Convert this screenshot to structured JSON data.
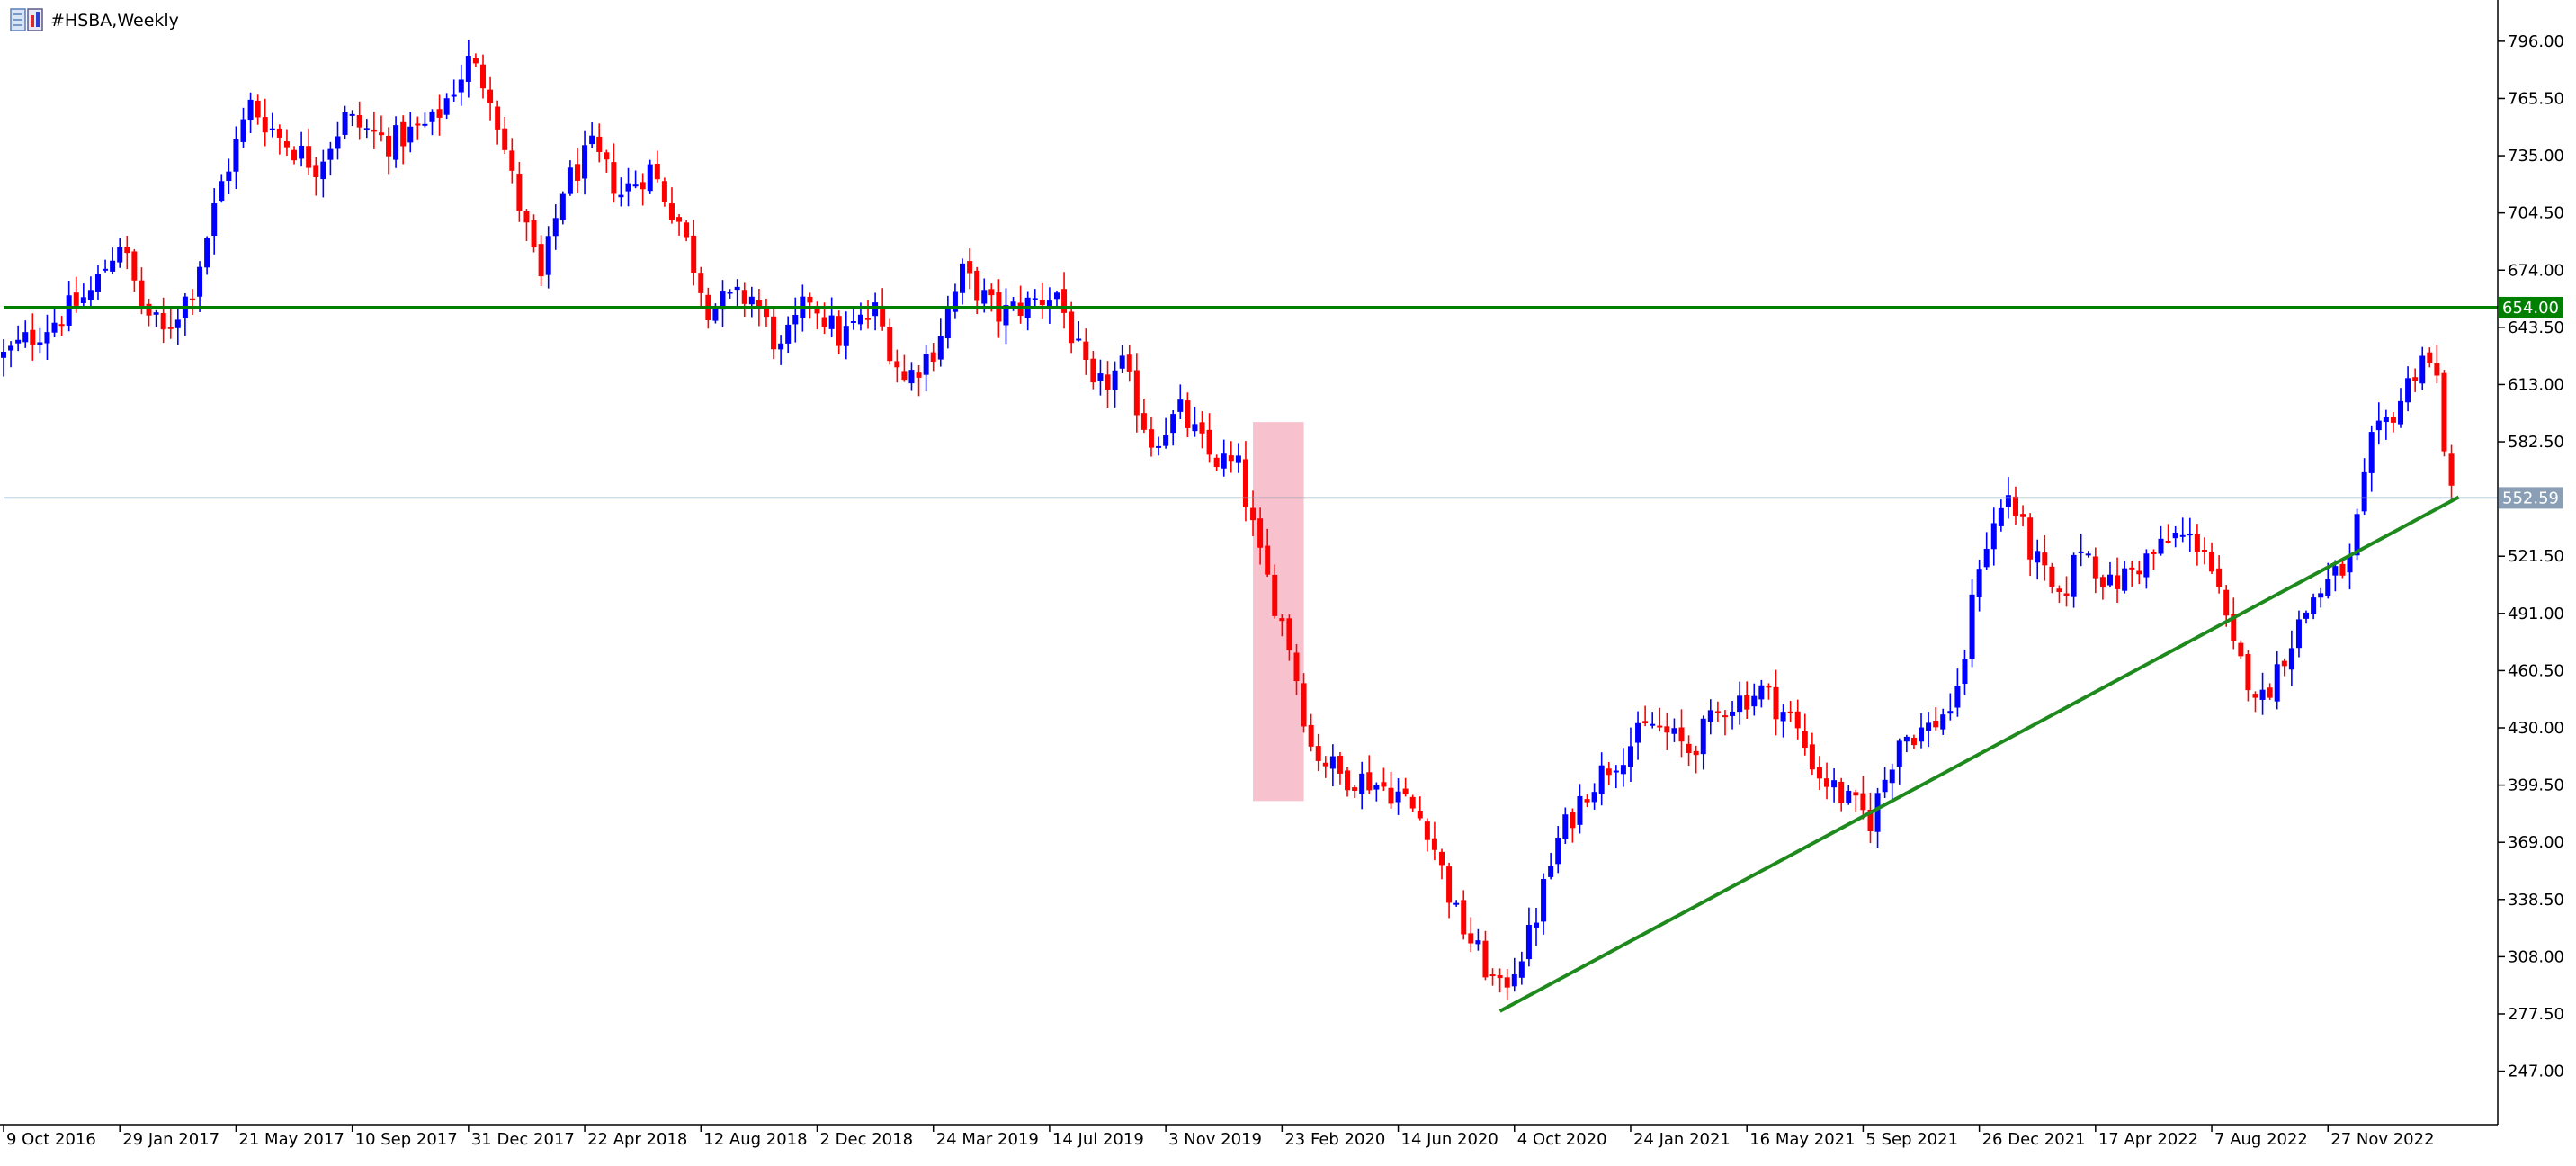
{
  "window": {
    "symbol_title": "#HSBA,Weekly"
  },
  "chart_data": {
    "type": "candlestick",
    "symbol": "#HSBA",
    "timeframe": "Weekly",
    "ylim": [
      218.5,
      818
    ],
    "xlim_dates": [
      "2016-10-09",
      "2023-05-07"
    ],
    "y_ticks": [
      "796.00",
      "765.50",
      "735.00",
      "704.50",
      "674.00",
      "643.50",
      "613.00",
      "582.50",
      "552.50",
      "521.50",
      "491.00",
      "460.50",
      "430.00",
      "399.50",
      "369.00",
      "338.50",
      "308.00",
      "277.50",
      "247.00"
    ],
    "x_ticks": [
      {
        "label": "9 Oct 2016",
        "date": "2016-10-09"
      },
      {
        "label": "29 Jan 2017",
        "date": "2017-01-29"
      },
      {
        "label": "21 May 2017",
        "date": "2017-05-21"
      },
      {
        "label": "10 Sep 2017",
        "date": "2017-09-10"
      },
      {
        "label": "31 Dec 2017",
        "date": "2017-12-31"
      },
      {
        "label": "22 Apr 2018",
        "date": "2018-04-22"
      },
      {
        "label": "12 Aug 2018",
        "date": "2018-08-12"
      },
      {
        "label": "2 Dec 2018",
        "date": "2018-12-02"
      },
      {
        "label": "24 Mar 2019",
        "date": "2019-03-24"
      },
      {
        "label": "14 Jul 2019",
        "date": "2019-07-14"
      },
      {
        "label": "3 Nov 2019",
        "date": "2019-11-03"
      },
      {
        "label": "23 Feb 2020",
        "date": "2020-02-23"
      },
      {
        "label": "14 Jun 2020",
        "date": "2020-06-14"
      },
      {
        "label": "4 Oct 2020",
        "date": "2020-10-04"
      },
      {
        "label": "24 Jan 2021",
        "date": "2021-01-24"
      },
      {
        "label": "16 May 2021",
        "date": "2021-05-16"
      },
      {
        "label": "5 Sep 2021",
        "date": "2021-09-05"
      },
      {
        "label": "26 Dec 2021",
        "date": "2021-12-26"
      },
      {
        "label": "17 Apr 2022",
        "date": "2022-04-17"
      },
      {
        "label": "7 Aug 2022",
        "date": "2022-08-07"
      },
      {
        "label": "27 Nov 2022",
        "date": "2022-11-27"
      }
    ],
    "horizontal_levels": [
      {
        "value": 654.0,
        "label": "654.00",
        "color": "#008000"
      },
      {
        "value": 552.59,
        "label": "552.59",
        "color": "#8a9fb5"
      }
    ],
    "trendline": {
      "start": {
        "date": "2020-09-20",
        "value": 279
      },
      "end": {
        "date": "2023-04-02",
        "value": 553
      },
      "color": "#1e8a1e"
    },
    "highlight_zone": {
      "start_date": "2020-01-26",
      "end_date": "2020-03-15",
      "low": 391,
      "high": 593,
      "color": "#f7b6c6"
    },
    "colors": {
      "bull": "#0000ff",
      "bear": "#ff0000",
      "background": "#ffffff",
      "axis": "#000000"
    },
    "anchors": [
      [
        "2016-10-09",
        628
      ],
      [
        "2016-12-04",
        650
      ],
      [
        "2017-01-01",
        662
      ],
      [
        "2017-01-29",
        690
      ],
      [
        "2017-02-19",
        655
      ],
      [
        "2017-03-12",
        640
      ],
      [
        "2017-04-09",
        665
      ],
      [
        "2017-05-07",
        720
      ],
      [
        "2017-06-04",
        762
      ],
      [
        "2017-07-02",
        745
      ],
      [
        "2017-08-06",
        730
      ],
      [
        "2017-09-03",
        755
      ],
      [
        "2017-10-15",
        742
      ],
      [
        "2017-11-26",
        752
      ],
      [
        "2017-12-31",
        785
      ],
      [
        "2018-01-21",
        770
      ],
      [
        "2018-02-11",
        722
      ],
      [
        "2018-03-11",
        668
      ],
      [
        "2018-04-01",
        718
      ],
      [
        "2018-04-29",
        738
      ],
      [
        "2018-05-27",
        715
      ],
      [
        "2018-06-24",
        728
      ],
      [
        "2018-07-22",
        700
      ],
      [
        "2018-08-19",
        655
      ],
      [
        "2018-09-30",
        660
      ],
      [
        "2018-10-28",
        630
      ],
      [
        "2018-11-25",
        660
      ],
      [
        "2018-12-23",
        638
      ],
      [
        "2019-01-27",
        652
      ],
      [
        "2019-02-24",
        615
      ],
      [
        "2019-03-24",
        632
      ],
      [
        "2019-04-21",
        672
      ],
      [
        "2019-05-26",
        650
      ],
      [
        "2019-06-23",
        656
      ],
      [
        "2019-07-21",
        662
      ],
      [
        "2019-08-25",
        608
      ],
      [
        "2019-09-22",
        622
      ],
      [
        "2019-10-20",
        583
      ],
      [
        "2019-11-17",
        598
      ],
      [
        "2019-12-15",
        575
      ],
      [
        "2020-01-12",
        568
      ],
      [
        "2020-02-02",
        520
      ],
      [
        "2020-03-01",
        475
      ],
      [
        "2020-03-22",
        420
      ],
      [
        "2020-04-19",
        405
      ],
      [
        "2020-05-17",
        402
      ],
      [
        "2020-06-14",
        395
      ],
      [
        "2020-07-12",
        378
      ],
      [
        "2020-08-09",
        330
      ],
      [
        "2020-09-20",
        289
      ],
      [
        "2020-10-18",
        318
      ],
      [
        "2020-11-15",
        370
      ],
      [
        "2020-12-13",
        398
      ],
      [
        "2021-01-17",
        418
      ],
      [
        "2021-02-14",
        432
      ],
      [
        "2021-03-21",
        418
      ],
      [
        "2021-04-25",
        442
      ],
      [
        "2021-05-30",
        450
      ],
      [
        "2021-06-27",
        435
      ],
      [
        "2021-07-25",
        405
      ],
      [
        "2021-08-22",
        390
      ],
      [
        "2021-09-12",
        381
      ],
      [
        "2021-10-10",
        425
      ],
      [
        "2021-11-07",
        430
      ],
      [
        "2021-12-05",
        445
      ],
      [
        "2021-12-26",
        520
      ],
      [
        "2022-01-23",
        555
      ],
      [
        "2022-02-13",
        525
      ],
      [
        "2022-03-13",
        495
      ],
      [
        "2022-04-03",
        528
      ],
      [
        "2022-05-01",
        505
      ],
      [
        "2022-06-05",
        520
      ],
      [
        "2022-07-03",
        532
      ],
      [
        "2022-07-31",
        528
      ],
      [
        "2022-08-28",
        470
      ],
      [
        "2022-09-25",
        445
      ],
      [
        "2022-10-16",
        470
      ],
      [
        "2022-11-13",
        500
      ],
      [
        "2022-12-18",
        518
      ],
      [
        "2023-01-08",
        580
      ],
      [
        "2023-02-05",
        605
      ],
      [
        "2023-02-26",
        630
      ],
      [
        "2023-03-12",
        615
      ],
      [
        "2023-03-26",
        552
      ]
    ]
  }
}
